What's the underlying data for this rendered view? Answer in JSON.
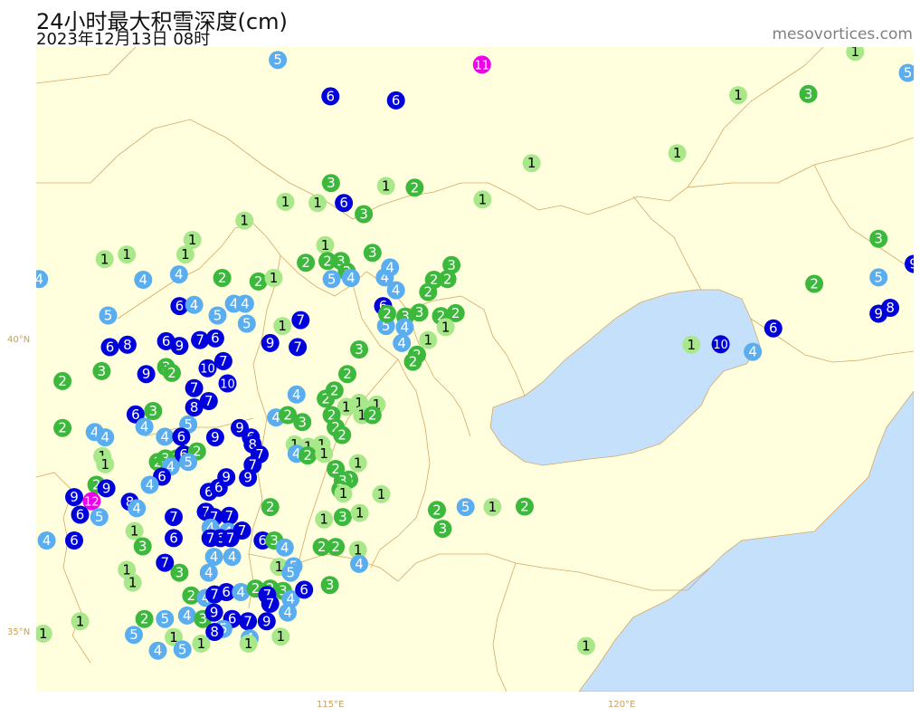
{
  "header": {
    "title": "24小时最大积雪深度(cm)",
    "subtitle": "2023年12月13日 08时",
    "credit": "mesovortices.com"
  },
  "axes": {
    "lat_40": "40°N",
    "lat_35": "35°N",
    "lon_115": "115°E",
    "lon_120": "120°E"
  },
  "map": {
    "lon_range": [
      110.0,
      125.0
    ],
    "lat_range": [
      34.0,
      45.0
    ],
    "land_color": "#ffffdd",
    "sea_color": "#c5e0fb",
    "border_color": "#d4a868"
  },
  "legend_colors": {
    "1": "#a8e88a",
    "2": "#3cb83c",
    "3": "#3cb83c",
    "4": "#5aaeef",
    "5": "#5aaeef",
    "6": "#0000dd",
    "7": "#0000dd",
    "8": "#0000dd",
    "9": "#0000dd",
    "10": "#0000dd",
    "11": "#ee00ee",
    "12": "#ee00ee"
  },
  "stations": [
    {
      "lon": 114.13,
      "lat": 44.78,
      "v": 5
    },
    {
      "lon": 117.62,
      "lat": 44.7,
      "v": 11
    },
    {
      "lon": 115.03,
      "lat": 44.16,
      "v": 6
    },
    {
      "lon": 116.15,
      "lat": 44.09,
      "v": 6
    },
    {
      "lon": 124.0,
      "lat": 44.92,
      "v": 1
    },
    {
      "lon": 124.9,
      "lat": 44.56,
      "v": 5
    },
    {
      "lon": 123.2,
      "lat": 44.2,
      "v": 3
    },
    {
      "lon": 122.0,
      "lat": 44.18,
      "v": 1
    },
    {
      "lon": 120.96,
      "lat": 43.19,
      "v": 1
    },
    {
      "lon": 118.47,
      "lat": 43.02,
      "v": 1
    },
    {
      "lon": 115.04,
      "lat": 42.68,
      "v": 3
    },
    {
      "lon": 115.98,
      "lat": 42.63,
      "v": 1
    },
    {
      "lon": 116.47,
      "lat": 42.6,
      "v": 2
    },
    {
      "lon": 117.63,
      "lat": 42.4,
      "v": 1
    },
    {
      "lon": 114.26,
      "lat": 42.36,
      "v": 1
    },
    {
      "lon": 114.81,
      "lat": 42.34,
      "v": 1
    },
    {
      "lon": 115.26,
      "lat": 42.34,
      "v": 6
    },
    {
      "lon": 115.6,
      "lat": 42.15,
      "v": 3
    },
    {
      "lon": 113.56,
      "lat": 42.04,
      "v": 1
    },
    {
      "lon": 112.67,
      "lat": 41.71,
      "v": 1
    },
    {
      "lon": 114.94,
      "lat": 41.62,
      "v": 1
    },
    {
      "lon": 124.4,
      "lat": 41.73,
      "v": 3
    },
    {
      "lon": 111.17,
      "lat": 41.38,
      "v": 1
    },
    {
      "lon": 111.55,
      "lat": 41.46,
      "v": 1
    },
    {
      "lon": 112.55,
      "lat": 41.46,
      "v": 1
    },
    {
      "lon": 115.75,
      "lat": 41.49,
      "v": 3
    },
    {
      "lon": 114.61,
      "lat": 41.32,
      "v": 2
    },
    {
      "lon": 114.98,
      "lat": 41.35,
      "v": 2
    },
    {
      "lon": 115.21,
      "lat": 41.35,
      "v": 3
    },
    {
      "lon": 115.31,
      "lat": 41.17,
      "v": 3
    },
    {
      "lon": 125.0,
      "lat": 41.3,
      "v": 9
    },
    {
      "lon": 110.05,
      "lat": 41.04,
      "v": 4
    },
    {
      "lon": 111.83,
      "lat": 41.03,
      "v": 4
    },
    {
      "lon": 112.44,
      "lat": 41.12,
      "v": 4
    },
    {
      "lon": 113.18,
      "lat": 41.06,
      "v": 2
    },
    {
      "lon": 113.8,
      "lat": 41.0,
      "v": 2
    },
    {
      "lon": 114.06,
      "lat": 41.06,
      "v": 1
    },
    {
      "lon": 115.05,
      "lat": 41.04,
      "v": 5
    },
    {
      "lon": 115.38,
      "lat": 41.06,
      "v": 4
    },
    {
      "lon": 115.96,
      "lat": 41.07,
      "v": 4
    },
    {
      "lon": 116.05,
      "lat": 41.24,
      "v": 4
    },
    {
      "lon": 117.1,
      "lat": 41.28,
      "v": 3
    },
    {
      "lon": 116.8,
      "lat": 41.03,
      "v": 2
    },
    {
      "lon": 117.03,
      "lat": 41.04,
      "v": 2
    },
    {
      "lon": 116.15,
      "lat": 40.85,
      "v": 4
    },
    {
      "lon": 116.7,
      "lat": 40.82,
      "v": 2
    },
    {
      "lon": 123.3,
      "lat": 40.96,
      "v": 2
    },
    {
      "lon": 124.4,
      "lat": 41.07,
      "v": 5
    },
    {
      "lon": 112.45,
      "lat": 40.58,
      "v": 6
    },
    {
      "lon": 112.7,
      "lat": 40.6,
      "v": 4
    },
    {
      "lon": 113.1,
      "lat": 40.42,
      "v": 5
    },
    {
      "lon": 113.38,
      "lat": 40.62,
      "v": 4
    },
    {
      "lon": 113.57,
      "lat": 40.62,
      "v": 4
    },
    {
      "lon": 113.6,
      "lat": 40.28,
      "v": 5
    },
    {
      "lon": 111.23,
      "lat": 40.42,
      "v": 5
    },
    {
      "lon": 114.21,
      "lat": 40.24,
      "v": 1
    },
    {
      "lon": 114.52,
      "lat": 40.34,
      "v": 7
    },
    {
      "lon": 115.93,
      "lat": 40.58,
      "v": 6
    },
    {
      "lon": 115.98,
      "lat": 40.24,
      "v": 5
    },
    {
      "lon": 116.31,
      "lat": 40.4,
      "v": 3
    },
    {
      "lon": 116.55,
      "lat": 40.47,
      "v": 3
    },
    {
      "lon": 116.92,
      "lat": 40.41,
      "v": 2
    },
    {
      "lon": 117.17,
      "lat": 40.46,
      "v": 2
    },
    {
      "lon": 117.0,
      "lat": 40.22,
      "v": 1
    },
    {
      "lon": 116.0,
      "lat": 40.45,
      "v": 2
    },
    {
      "lon": 116.3,
      "lat": 40.22,
      "v": 4
    },
    {
      "lon": 116.7,
      "lat": 40.0,
      "v": 1
    },
    {
      "lon": 116.25,
      "lat": 39.95,
      "v": 4
    },
    {
      "lon": 116.51,
      "lat": 39.75,
      "v": 2
    },
    {
      "lon": 116.44,
      "lat": 39.63,
      "v": 2
    },
    {
      "lon": 124.4,
      "lat": 40.45,
      "v": 9
    },
    {
      "lon": 124.6,
      "lat": 40.55,
      "v": 8
    },
    {
      "lon": 122.6,
      "lat": 40.2,
      "v": 6
    },
    {
      "lon": 121.7,
      "lat": 39.93,
      "v": 10
    },
    {
      "lon": 121.2,
      "lat": 39.92,
      "v": 1
    },
    {
      "lon": 122.25,
      "lat": 39.8,
      "v": 4
    },
    {
      "lon": 111.26,
      "lat": 39.88,
      "v": 6
    },
    {
      "lon": 111.56,
      "lat": 39.92,
      "v": 8
    },
    {
      "lon": 112.22,
      "lat": 39.98,
      "v": 6
    },
    {
      "lon": 112.45,
      "lat": 39.9,
      "v": 9
    },
    {
      "lon": 112.8,
      "lat": 40.0,
      "v": 7
    },
    {
      "lon": 113.06,
      "lat": 40.03,
      "v": 6
    },
    {
      "lon": 114.0,
      "lat": 39.95,
      "v": 9
    },
    {
      "lon": 114.47,
      "lat": 39.88,
      "v": 7
    },
    {
      "lon": 115.52,
      "lat": 39.84,
      "v": 3
    },
    {
      "lon": 111.12,
      "lat": 39.47,
      "v": 3
    },
    {
      "lon": 111.88,
      "lat": 39.42,
      "v": 9
    },
    {
      "lon": 112.22,
      "lat": 39.54,
      "v": 3
    },
    {
      "lon": 112.32,
      "lat": 39.44,
      "v": 2
    },
    {
      "lon": 112.93,
      "lat": 39.52,
      "v": 10
    },
    {
      "lon": 113.2,
      "lat": 39.64,
      "v": 7
    },
    {
      "lon": 113.27,
      "lat": 39.26,
      "v": 10
    },
    {
      "lon": 115.32,
      "lat": 39.42,
      "v": 2
    },
    {
      "lon": 110.45,
      "lat": 39.3,
      "v": 2
    },
    {
      "lon": 112.7,
      "lat": 39.18,
      "v": 7
    },
    {
      "lon": 112.95,
      "lat": 38.96,
      "v": 7
    },
    {
      "lon": 114.45,
      "lat": 39.07,
      "v": 4
    },
    {
      "lon": 114.95,
      "lat": 39.0,
      "v": 2
    },
    {
      "lon": 115.1,
      "lat": 39.14,
      "v": 2
    },
    {
      "lon": 115.52,
      "lat": 38.93,
      "v": 1
    },
    {
      "lon": 115.82,
      "lat": 38.9,
      "v": 1
    },
    {
      "lon": 115.3,
      "lat": 38.86,
      "v": 1
    },
    {
      "lon": 115.57,
      "lat": 38.72,
      "v": 1
    },
    {
      "lon": 115.75,
      "lat": 38.72,
      "v": 2
    },
    {
      "lon": 111.7,
      "lat": 38.73,
      "v": 6
    },
    {
      "lon": 112.0,
      "lat": 38.79,
      "v": 3
    },
    {
      "lon": 112.7,
      "lat": 38.85,
      "v": 8
    },
    {
      "lon": 114.1,
      "lat": 38.68,
      "v": 4
    },
    {
      "lon": 114.3,
      "lat": 38.72,
      "v": 2
    },
    {
      "lon": 114.55,
      "lat": 38.6,
      "v": 3
    },
    {
      "lon": 115.05,
      "lat": 38.72,
      "v": 2
    },
    {
      "lon": 115.12,
      "lat": 38.51,
      "v": 2
    },
    {
      "lon": 115.23,
      "lat": 38.38,
      "v": 2
    },
    {
      "lon": 111.85,
      "lat": 38.52,
      "v": 4
    },
    {
      "lon": 112.6,
      "lat": 38.56,
      "v": 5
    },
    {
      "lon": 110.45,
      "lat": 38.5,
      "v": 2
    },
    {
      "lon": 111.0,
      "lat": 38.43,
      "v": 4
    },
    {
      "lon": 111.18,
      "lat": 38.34,
      "v": 4
    },
    {
      "lon": 112.2,
      "lat": 38.35,
      "v": 4
    },
    {
      "lon": 112.48,
      "lat": 38.35,
      "v": 6
    },
    {
      "lon": 113.06,
      "lat": 38.34,
      "v": 9
    },
    {
      "lon": 113.48,
      "lat": 38.5,
      "v": 9
    },
    {
      "lon": 113.67,
      "lat": 38.34,
      "v": 6
    },
    {
      "lon": 113.7,
      "lat": 38.22,
      "v": 8
    },
    {
      "lon": 113.82,
      "lat": 38.05,
      "v": 7
    },
    {
      "lon": 114.42,
      "lat": 38.22,
      "v": 1
    },
    {
      "lon": 114.65,
      "lat": 38.18,
      "v": 1
    },
    {
      "lon": 114.88,
      "lat": 38.22,
      "v": 1
    },
    {
      "lon": 114.45,
      "lat": 38.06,
      "v": 4
    },
    {
      "lon": 114.64,
      "lat": 38.03,
      "v": 2
    },
    {
      "lon": 114.92,
      "lat": 38.06,
      "v": 1
    },
    {
      "lon": 111.13,
      "lat": 38.02,
      "v": 1
    },
    {
      "lon": 111.18,
      "lat": 37.88,
      "v": 1
    },
    {
      "lon": 112.08,
      "lat": 37.92,
      "v": 2
    },
    {
      "lon": 112.21,
      "lat": 37.98,
      "v": 3
    },
    {
      "lon": 112.4,
      "lat": 37.98,
      "v": 3
    },
    {
      "lon": 112.52,
      "lat": 38.05,
      "v": 6
    },
    {
      "lon": 112.75,
      "lat": 38.1,
      "v": 2
    },
    {
      "lon": 112.3,
      "lat": 37.84,
      "v": 4
    },
    {
      "lon": 112.6,
      "lat": 37.92,
      "v": 5
    },
    {
      "lon": 112.15,
      "lat": 37.67,
      "v": 6
    },
    {
      "lon": 113.7,
      "lat": 37.87,
      "v": 7
    },
    {
      "lon": 115.12,
      "lat": 37.8,
      "v": 2
    },
    {
      "lon": 115.5,
      "lat": 37.9,
      "v": 1
    },
    {
      "lon": 115.35,
      "lat": 37.62,
      "v": 3
    },
    {
      "lon": 115.24,
      "lat": 37.6,
      "v": 3
    },
    {
      "lon": 115.2,
      "lat": 37.45,
      "v": 2
    },
    {
      "lon": 115.25,
      "lat": 37.38,
      "v": 1
    },
    {
      "lon": 111.03,
      "lat": 37.53,
      "v": 2
    },
    {
      "lon": 111.2,
      "lat": 37.47,
      "v": 9
    },
    {
      "lon": 111.94,
      "lat": 37.53,
      "v": 4
    },
    {
      "lon": 112.95,
      "lat": 37.41,
      "v": 6
    },
    {
      "lon": 113.12,
      "lat": 37.48,
      "v": 6
    },
    {
      "lon": 113.25,
      "lat": 37.66,
      "v": 9
    },
    {
      "lon": 113.62,
      "lat": 37.65,
      "v": 9
    },
    {
      "lon": 115.9,
      "lat": 37.37,
      "v": 1
    },
    {
      "lon": 110.65,
      "lat": 37.32,
      "v": 9
    },
    {
      "lon": 110.95,
      "lat": 37.25,
      "v": 12
    },
    {
      "lon": 111.6,
      "lat": 37.24,
      "v": 8
    },
    {
      "lon": 111.72,
      "lat": 37.13,
      "v": 4
    },
    {
      "lon": 112.35,
      "lat": 36.98,
      "v": 7
    },
    {
      "lon": 112.9,
      "lat": 37.07,
      "v": 7
    },
    {
      "lon": 113.3,
      "lat": 37.0,
      "v": 7
    },
    {
      "lon": 113.04,
      "lat": 36.98,
      "v": 7
    },
    {
      "lon": 110.75,
      "lat": 37.02,
      "v": 6
    },
    {
      "lon": 111.08,
      "lat": 36.98,
      "v": 5
    },
    {
      "lon": 114.0,
      "lat": 37.15,
      "v": 2
    },
    {
      "lon": 114.92,
      "lat": 36.94,
      "v": 1
    },
    {
      "lon": 115.24,
      "lat": 36.98,
      "v": 3
    },
    {
      "lon": 115.53,
      "lat": 37.05,
      "v": 1
    },
    {
      "lon": 116.85,
      "lat": 37.1,
      "v": 2
    },
    {
      "lon": 117.34,
      "lat": 37.15,
      "v": 5
    },
    {
      "lon": 117.8,
      "lat": 37.15,
      "v": 1
    },
    {
      "lon": 118.35,
      "lat": 37.16,
      "v": 2
    },
    {
      "lon": 116.95,
      "lat": 36.78,
      "v": 3
    },
    {
      "lon": 111.68,
      "lat": 36.74,
      "v": 1
    },
    {
      "lon": 112.98,
      "lat": 36.8,
      "v": 4
    },
    {
      "lon": 113.28,
      "lat": 36.73,
      "v": 4
    },
    {
      "lon": 113.52,
      "lat": 36.75,
      "v": 7
    },
    {
      "lon": 113.15,
      "lat": 36.62,
      "v": 6
    },
    {
      "lon": 113.32,
      "lat": 36.62,
      "v": 7
    },
    {
      "lon": 112.98,
      "lat": 36.62,
      "v": 7
    },
    {
      "lon": 110.18,
      "lat": 36.58,
      "v": 4
    },
    {
      "lon": 110.65,
      "lat": 36.58,
      "v": 6
    },
    {
      "lon": 111.82,
      "lat": 36.48,
      "v": 3
    },
    {
      "lon": 112.35,
      "lat": 36.62,
      "v": 6
    },
    {
      "lon": 113.87,
      "lat": 36.58,
      "v": 6
    },
    {
      "lon": 114.07,
      "lat": 36.58,
      "v": 3
    },
    {
      "lon": 114.25,
      "lat": 36.46,
      "v": 4
    },
    {
      "lon": 114.88,
      "lat": 36.47,
      "v": 2
    },
    {
      "lon": 115.12,
      "lat": 36.47,
      "v": 2
    },
    {
      "lon": 115.5,
      "lat": 36.42,
      "v": 1
    },
    {
      "lon": 115.52,
      "lat": 36.18,
      "v": 4
    },
    {
      "lon": 113.04,
      "lat": 36.3,
      "v": 4
    },
    {
      "lon": 113.35,
      "lat": 36.3,
      "v": 4
    },
    {
      "lon": 112.2,
      "lat": 36.2,
      "v": 7
    },
    {
      "lon": 114.15,
      "lat": 36.13,
      "v": 1
    },
    {
      "lon": 114.4,
      "lat": 36.14,
      "v": 5
    },
    {
      "lon": 114.35,
      "lat": 36.03,
      "v": 5
    },
    {
      "lon": 111.55,
      "lat": 36.08,
      "v": 1
    },
    {
      "lon": 111.65,
      "lat": 35.86,
      "v": 1
    },
    {
      "lon": 112.45,
      "lat": 36.03,
      "v": 3
    },
    {
      "lon": 112.95,
      "lat": 36.03,
      "v": 4
    },
    {
      "lon": 115.02,
      "lat": 35.82,
      "v": 3
    },
    {
      "lon": 112.65,
      "lat": 35.64,
      "v": 2
    },
    {
      "lon": 112.9,
      "lat": 35.6,
      "v": 4
    },
    {
      "lon": 113.05,
      "lat": 35.66,
      "v": 7
    },
    {
      "lon": 113.25,
      "lat": 35.7,
      "v": 6
    },
    {
      "lon": 113.5,
      "lat": 35.7,
      "v": 4
    },
    {
      "lon": 113.75,
      "lat": 35.76,
      "v": 2
    },
    {
      "lon": 114.0,
      "lat": 35.76,
      "v": 2
    },
    {
      "lon": 114.22,
      "lat": 35.72,
      "v": 3
    },
    {
      "lon": 113.95,
      "lat": 35.65,
      "v": 7
    },
    {
      "lon": 114.0,
      "lat": 35.5,
      "v": 7
    },
    {
      "lon": 114.35,
      "lat": 35.58,
      "v": 4
    },
    {
      "lon": 114.58,
      "lat": 35.74,
      "v": 6
    },
    {
      "lon": 110.75,
      "lat": 35.2,
      "v": 1
    },
    {
      "lon": 111.85,
      "lat": 35.24,
      "v": 2
    },
    {
      "lon": 112.2,
      "lat": 35.24,
      "v": 5
    },
    {
      "lon": 112.58,
      "lat": 35.3,
      "v": 4
    },
    {
      "lon": 112.85,
      "lat": 35.24,
      "v": 3
    },
    {
      "lon": 113.04,
      "lat": 35.35,
      "v": 9
    },
    {
      "lon": 113.35,
      "lat": 35.24,
      "v": 6
    },
    {
      "lon": 113.62,
      "lat": 35.2,
      "v": 7
    },
    {
      "lon": 113.94,
      "lat": 35.2,
      "v": 9
    },
    {
      "lon": 114.3,
      "lat": 35.35,
      "v": 4
    },
    {
      "lon": 113.2,
      "lat": 35.07,
      "v": 5
    },
    {
      "lon": 113.05,
      "lat": 35.02,
      "v": 8
    },
    {
      "lon": 113.65,
      "lat": 34.91,
      "v": 4
    },
    {
      "lon": 114.18,
      "lat": 34.94,
      "v": 1
    },
    {
      "lon": 110.12,
      "lat": 34.99,
      "v": 1
    },
    {
      "lon": 111.67,
      "lat": 34.97,
      "v": 5
    },
    {
      "lon": 112.35,
      "lat": 34.93,
      "v": 1
    },
    {
      "lon": 112.82,
      "lat": 34.82,
      "v": 1
    },
    {
      "lon": 112.08,
      "lat": 34.7,
      "v": 4
    },
    {
      "lon": 112.5,
      "lat": 34.72,
      "v": 5
    },
    {
      "lon": 113.63,
      "lat": 34.82,
      "v": 1
    },
    {
      "lon": 119.4,
      "lat": 34.78,
      "v": 1
    }
  ]
}
